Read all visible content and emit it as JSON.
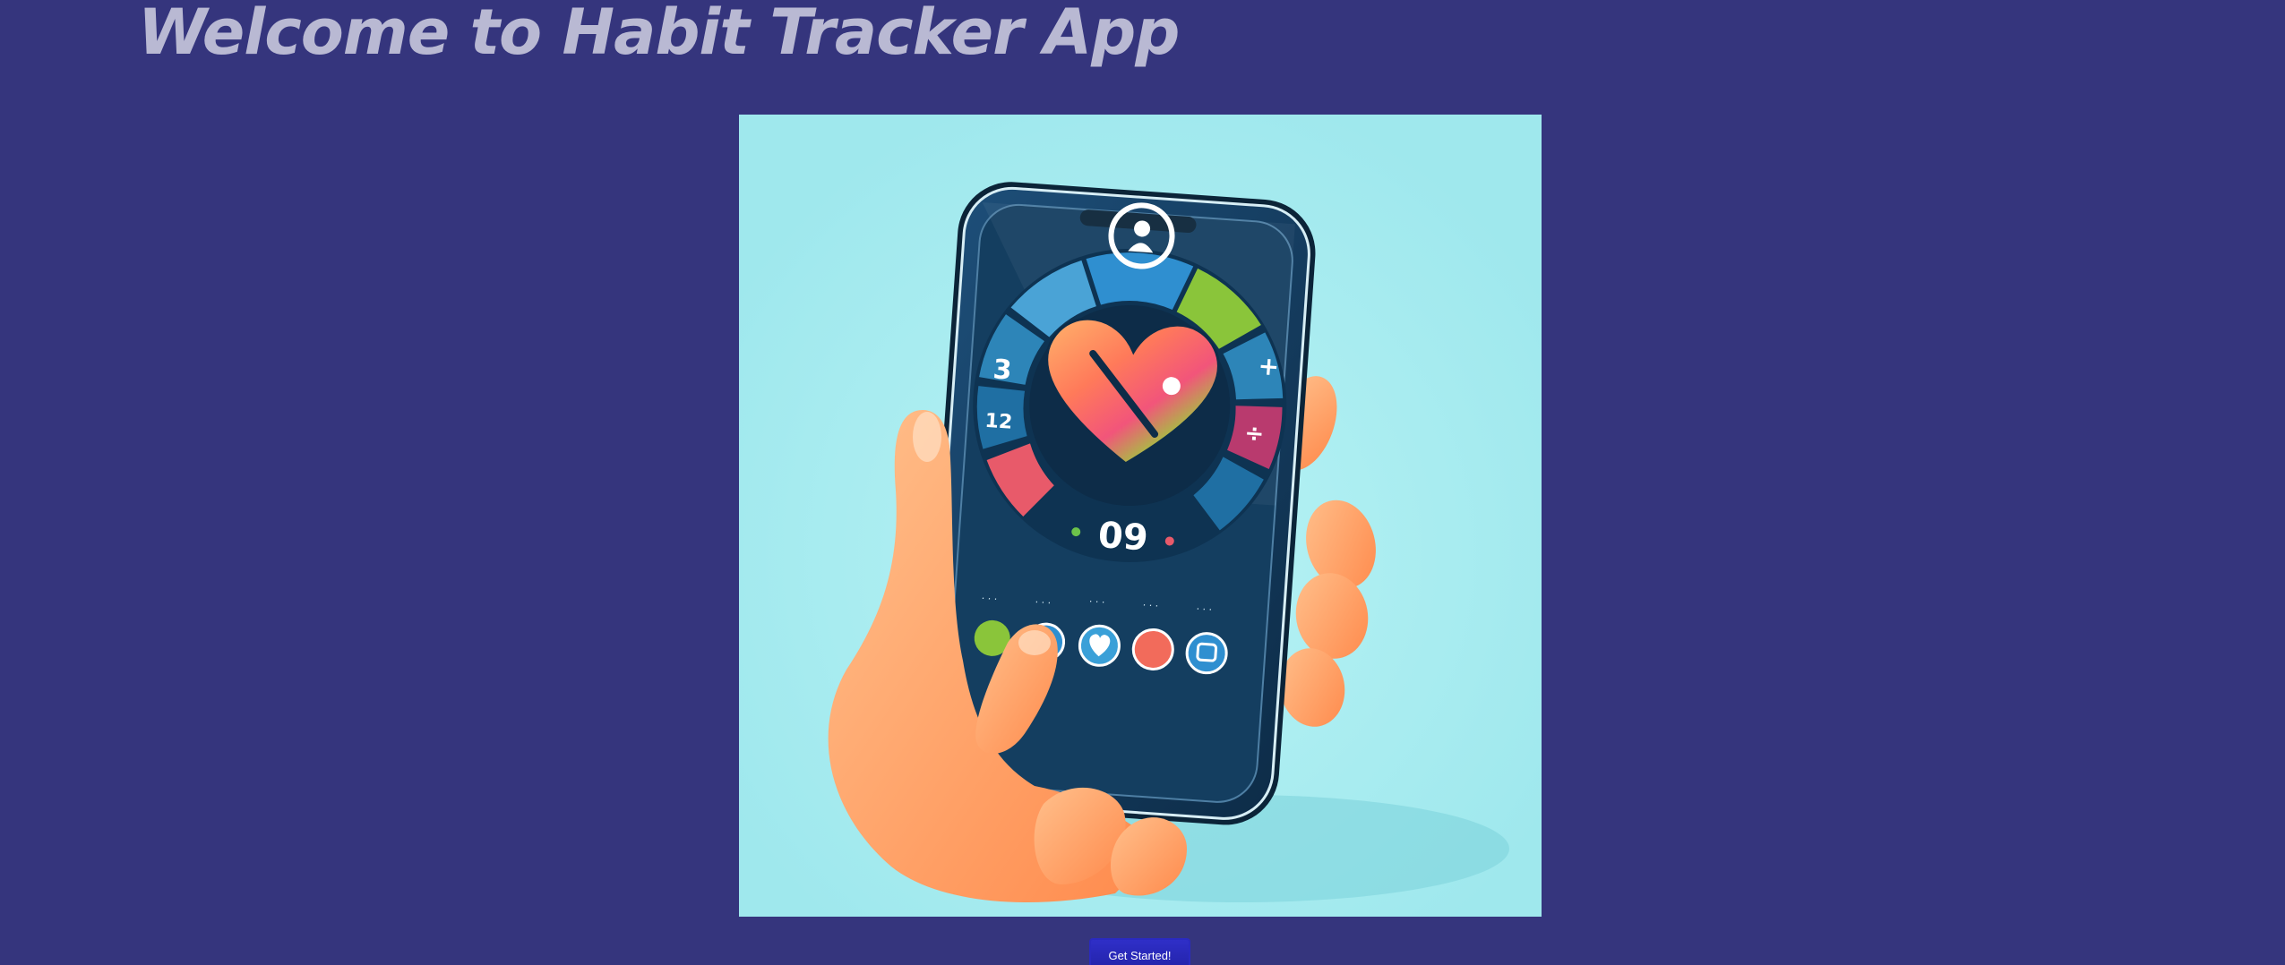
{
  "header": {
    "title": "Welcome to Habit Tracker App"
  },
  "hero": {
    "illustration_subject": "Hand holding a smartphone displaying a habit tracker dial with a colorful heart",
    "dial_readout": "09",
    "dial_labels": [
      "3",
      "12"
    ]
  },
  "actions": {
    "get_started_label": "Get Started!"
  },
  "colors": {
    "page_background": "#35357d",
    "title_text": "#b9b9d3",
    "hero_background": "#a0eaee",
    "button_background": "#2626b8",
    "phone_body": "#123a5c"
  }
}
